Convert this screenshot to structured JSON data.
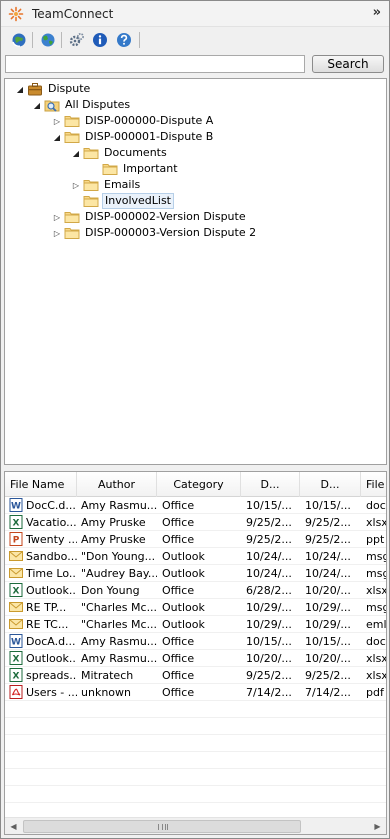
{
  "app": {
    "title": "TeamConnect",
    "collapse_glyph": "»"
  },
  "toolbar": {
    "buttons": [
      {
        "icon": "refresh-globe-icon"
      },
      {
        "icon": "web-globe-icon"
      },
      {
        "icon": "settings-gears-icon"
      },
      {
        "icon": "info-icon"
      },
      {
        "icon": "help-icon"
      }
    ]
  },
  "search": {
    "value": "",
    "placeholder": "",
    "button_label": "Search"
  },
  "tree": {
    "items": [
      {
        "label": "Dispute",
        "icon": "briefcase-icon",
        "expanded": true
      },
      {
        "label": "All Disputes",
        "icon": "search-folder-icon",
        "expanded": true
      },
      {
        "label": "DISP-000000-Dispute A",
        "icon": "folder-icon",
        "expanded": false
      },
      {
        "label": "DISP-000001-Dispute B",
        "icon": "folder-icon",
        "expanded": true
      },
      {
        "label": "Documents",
        "icon": "folder-icon",
        "expanded": true
      },
      {
        "label": "Important",
        "icon": "folder-icon"
      },
      {
        "label": "Emails",
        "icon": "folder-icon",
        "expanded": false
      },
      {
        "label": "InvolvedList",
        "icon": "folder-icon",
        "selected": true
      },
      {
        "label": "DISP-000002-Version Dispute",
        "icon": "folder-icon",
        "expanded": false
      },
      {
        "label": "DISP-000003-Version Dispute 2",
        "icon": "folder-icon",
        "expanded": false
      }
    ]
  },
  "grid": {
    "columns": [
      "File Name",
      "Author",
      "Category",
      "D...",
      "D...",
      "File"
    ],
    "rows": [
      {
        "icon": "word-doc-icon",
        "name": "DocC.d...",
        "author": "Amy Rasmu...",
        "category": "Office",
        "d1": "10/15/...",
        "d2": "10/15/...",
        "file": "doc"
      },
      {
        "icon": "excel-icon",
        "name": "Vacatio...",
        "author": "Amy Pruske",
        "category": "Office",
        "d1": "9/25/2...",
        "d2": "9/25/2...",
        "file": "xlsx"
      },
      {
        "icon": "powerpoint-icon",
        "name": "Twenty ...",
        "author": "Amy Pruske",
        "category": "Office",
        "d1": "9/25/2...",
        "d2": "9/25/2...",
        "file": "ppt"
      },
      {
        "icon": "email-icon",
        "name": "Sandbo...",
        "author": "\"Don Young...",
        "category": "Outlook",
        "d1": "10/24/...",
        "d2": "10/24/...",
        "file": "msg"
      },
      {
        "icon": "email-icon",
        "name": "Time Lo...",
        "author": "\"Audrey Bay...",
        "category": "Outlook",
        "d1": "10/24/...",
        "d2": "10/24/...",
        "file": "msg"
      },
      {
        "icon": "excel-icon",
        "name": "Outlook...",
        "author": "Don Young",
        "category": "Office",
        "d1": "6/28/2...",
        "d2": "10/20/...",
        "file": "xlsx"
      },
      {
        "icon": "email-icon",
        "name": "RE TP...",
        "author": "\"Charles Mc...",
        "category": "Outlook",
        "d1": "10/29/...",
        "d2": "10/29/...",
        "file": "msg"
      },
      {
        "icon": "email-icon",
        "name": "RE TC...",
        "author": "\"Charles Mc...",
        "category": "Outlook",
        "d1": "10/29/...",
        "d2": "10/29/...",
        "file": "eml"
      },
      {
        "icon": "word-doc-icon",
        "name": "DocA.d...",
        "author": "Amy Rasmu...",
        "category": "Office",
        "d1": "10/15/...",
        "d2": "10/15/...",
        "file": "doc"
      },
      {
        "icon": "excel-icon",
        "name": "Outlook...",
        "author": "Amy Rasmu...",
        "category": "Office",
        "d1": "10/20/...",
        "d2": "10/20/...",
        "file": "xlsx"
      },
      {
        "icon": "excel-icon",
        "name": "spreads...",
        "author": "Mitratech",
        "category": "Office",
        "d1": "9/25/2...",
        "d2": "9/25/2...",
        "file": "xlsx"
      },
      {
        "icon": "pdf-icon",
        "name": "Users - ...",
        "author": "unknown",
        "category": "Office",
        "d1": "7/14/2...",
        "d2": "7/14/2...",
        "file": "pdf"
      }
    ],
    "empty_rows": 8
  }
}
